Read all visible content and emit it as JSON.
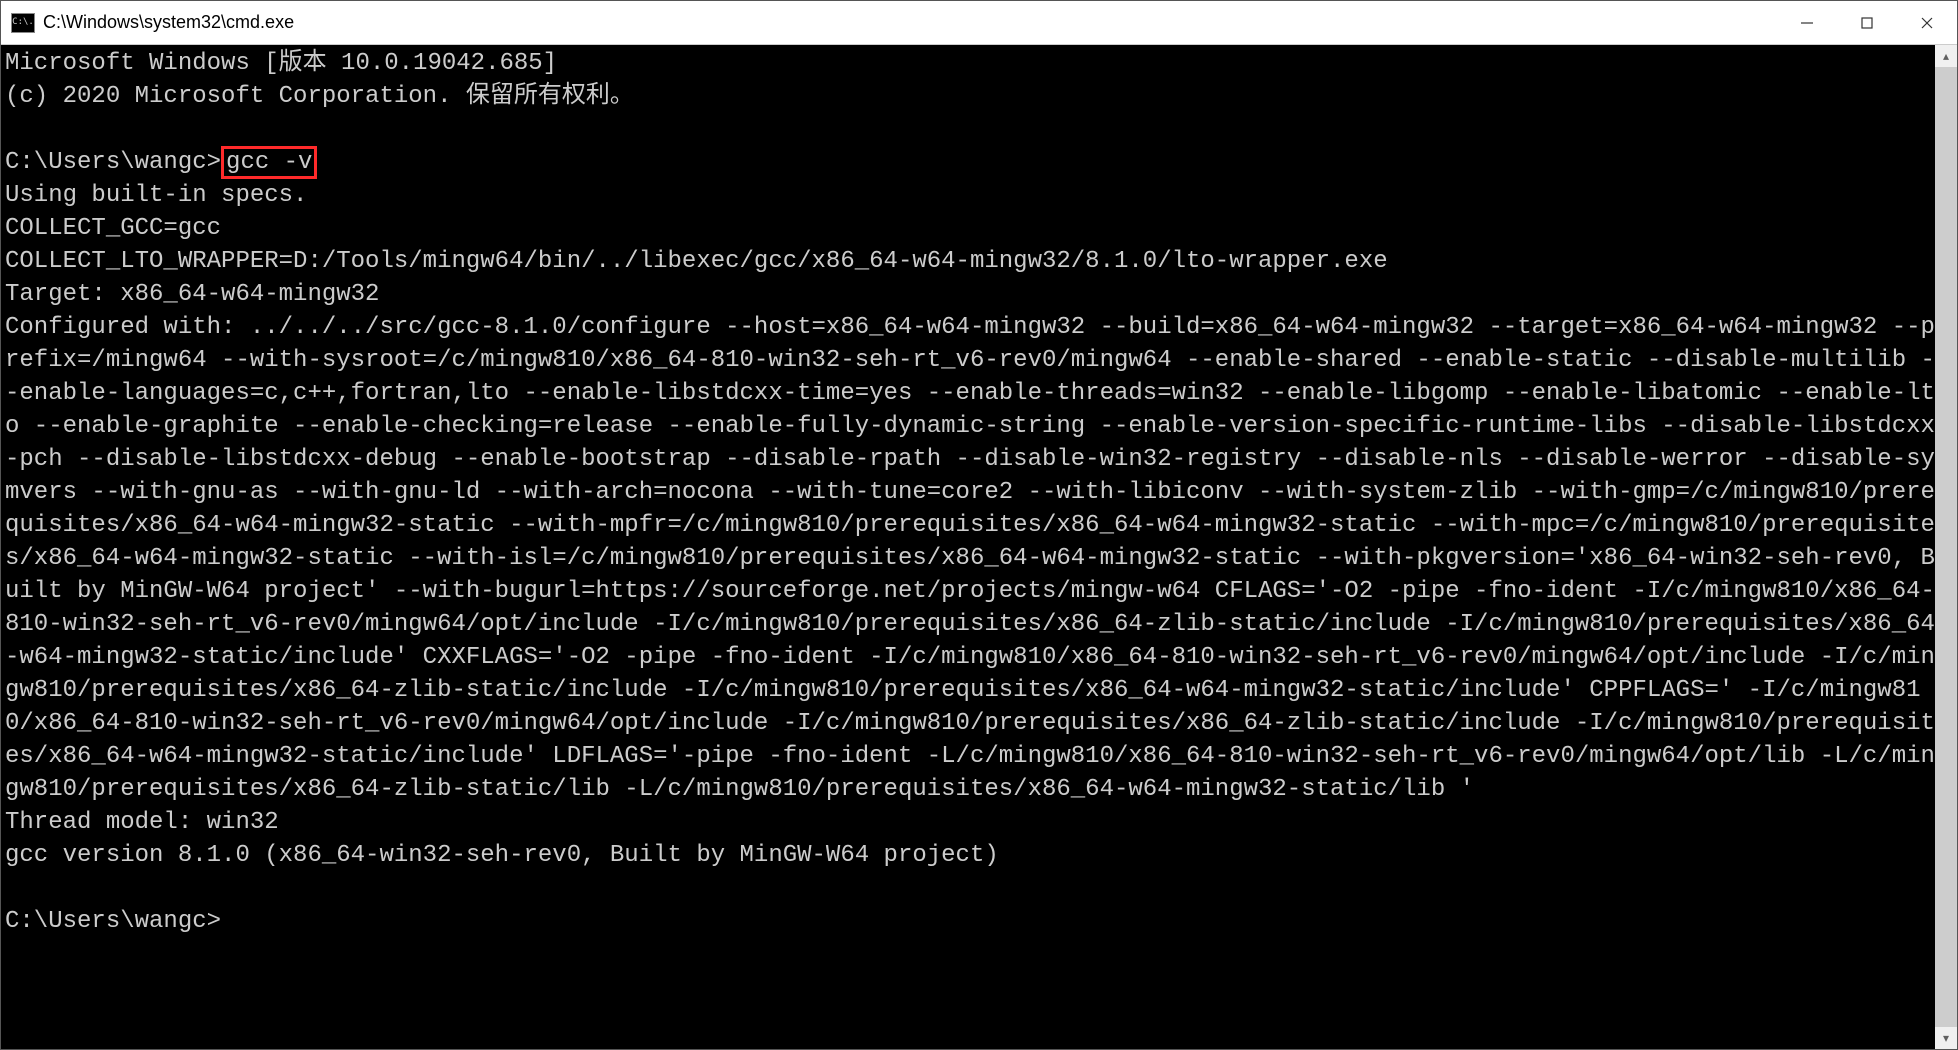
{
  "window": {
    "title": "C:\\Windows\\system32\\cmd.exe",
    "icon_text": "C:\\."
  },
  "terminal": {
    "header_line1": "Microsoft Windows [版本 10.0.19042.685]",
    "header_line2": "(c) 2020 Microsoft Corporation. 保留所有权利。",
    "prompt1_prefix": "C:\\Users\\wangc>",
    "prompt1_cmd": "gcc -v",
    "output_block": "Using built-in specs.\nCOLLECT_GCC=gcc\nCOLLECT_LTO_WRAPPER=D:/Tools/mingw64/bin/../libexec/gcc/x86_64-w64-mingw32/8.1.0/lto-wrapper.exe\nTarget: x86_64-w64-mingw32\nConfigured with: ../../../src/gcc-8.1.0/configure --host=x86_64-w64-mingw32 --build=x86_64-w64-mingw32 --target=x86_64-w64-mingw32 --prefix=/mingw64 --with-sysroot=/c/mingw810/x86_64-810-win32-seh-rt_v6-rev0/mingw64 --enable-shared --enable-static --disable-multilib --enable-languages=c,c++,fortran,lto --enable-libstdcxx-time=yes --enable-threads=win32 --enable-libgomp --enable-libatomic --enable-lto --enable-graphite --enable-checking=release --enable-fully-dynamic-string --enable-version-specific-runtime-libs --disable-libstdcxx-pch --disable-libstdcxx-debug --enable-bootstrap --disable-rpath --disable-win32-registry --disable-nls --disable-werror --disable-symvers --with-gnu-as --with-gnu-ld --with-arch=nocona --with-tune=core2 --with-libiconv --with-system-zlib --with-gmp=/c/mingw810/prerequisites/x86_64-w64-mingw32-static --with-mpfr=/c/mingw810/prerequisites/x86_64-w64-mingw32-static --with-mpc=/c/mingw810/prerequisites/x86_64-w64-mingw32-static --with-isl=/c/mingw810/prerequisites/x86_64-w64-mingw32-static --with-pkgversion='x86_64-win32-seh-rev0, Built by MinGW-W64 project' --with-bugurl=https://sourceforge.net/projects/mingw-w64 CFLAGS='-O2 -pipe -fno-ident -I/c/mingw810/x86_64-810-win32-seh-rt_v6-rev0/mingw64/opt/include -I/c/mingw810/prerequisites/x86_64-zlib-static/include -I/c/mingw810/prerequisites/x86_64-w64-mingw32-static/include' CXXFLAGS='-O2 -pipe -fno-ident -I/c/mingw810/x86_64-810-win32-seh-rt_v6-rev0/mingw64/opt/include -I/c/mingw810/prerequisites/x86_64-zlib-static/include -I/c/mingw810/prerequisites/x86_64-w64-mingw32-static/include' CPPFLAGS=' -I/c/mingw810/x86_64-810-win32-seh-rt_v6-rev0/mingw64/opt/include -I/c/mingw810/prerequisites/x86_64-zlib-static/include -I/c/mingw810/prerequisites/x86_64-w64-mingw32-static/include' LDFLAGS='-pipe -fno-ident -L/c/mingw810/x86_64-810-win32-seh-rt_v6-rev0/mingw64/opt/lib -L/c/mingw810/prerequisites/x86_64-zlib-static/lib -L/c/mingw810/prerequisites/x86_64-w64-mingw32-static/lib '\nThread model: win32\ngcc version 8.1.0 (x86_64-win32-seh-rev0, Built by MinGW-W64 project)",
    "prompt2": "C:\\Users\\wangc>"
  }
}
